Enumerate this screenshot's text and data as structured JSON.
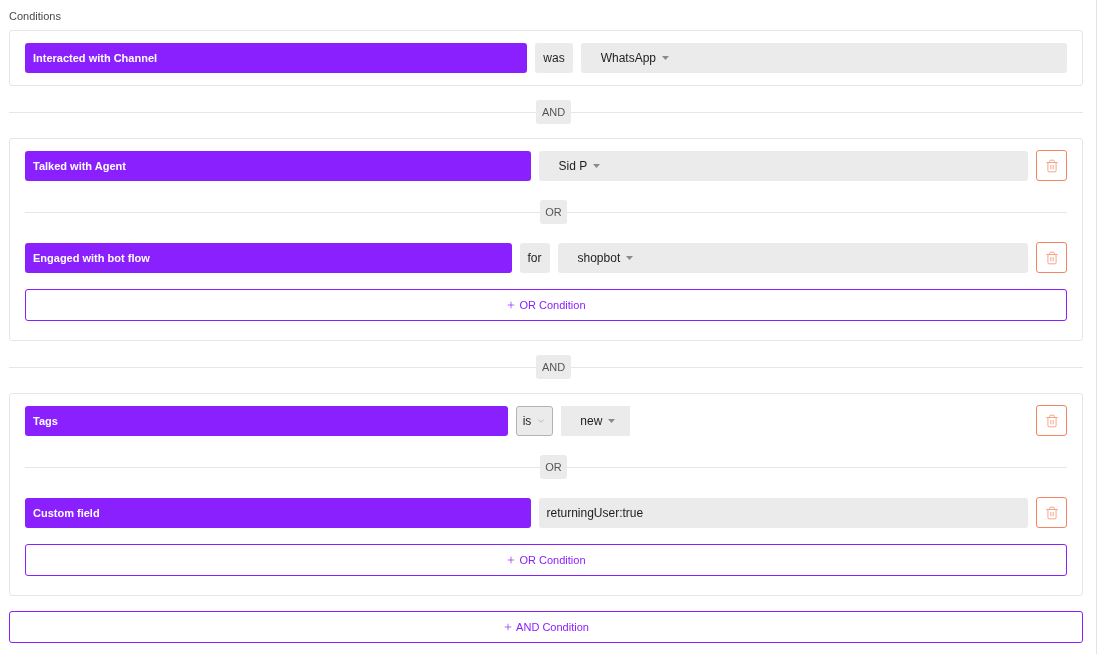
{
  "section": {
    "title": "Conditions"
  },
  "groups": [
    {
      "conditions": [
        {
          "field": "Interacted with Channel",
          "operator": {
            "kind": "label",
            "text": "was"
          },
          "value": {
            "kind": "dropdown",
            "text": "WhatsApp"
          },
          "deletable": false
        }
      ]
    },
    {
      "joiner": "AND",
      "conditions": [
        {
          "field": "Talked with Agent",
          "value": {
            "kind": "dropdown",
            "text": "Sid P"
          },
          "deletable": true
        },
        {
          "joiner": "OR",
          "field": "Engaged with bot flow",
          "operator": {
            "kind": "label",
            "text": "for"
          },
          "value": {
            "kind": "dropdown",
            "text": "shopbot"
          },
          "deletable": true
        }
      ],
      "add_button": "OR Condition"
    },
    {
      "joiner": "AND",
      "conditions": [
        {
          "field": "Tags",
          "operator": {
            "kind": "select",
            "text": "is"
          },
          "value": {
            "kind": "compact_dropdown",
            "text": "new"
          },
          "deletable": true
        },
        {
          "joiner": "OR",
          "field": "Custom field",
          "value": {
            "kind": "text",
            "text": "returningUser:true"
          },
          "deletable": true
        }
      ],
      "add_button": "OR Condition"
    }
  ],
  "add_and_button": "AND Condition"
}
